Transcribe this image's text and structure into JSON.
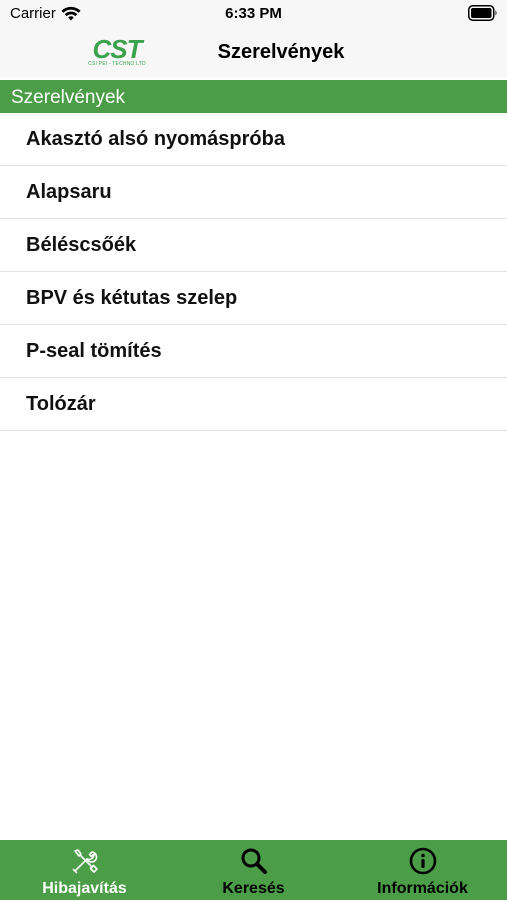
{
  "status_bar": {
    "carrier": "Carrier",
    "time": "6:33 PM",
    "wifi_icon": "wifi-icon",
    "battery_icon": "battery-icon"
  },
  "nav_bar": {
    "logo_text": "CST",
    "logo_subtext": "CSI PEI - TECHNO LTD",
    "title": "Szerelvények"
  },
  "section": {
    "header": "Szerelvények",
    "header_color": "#4b9e47"
  },
  "list": {
    "items": [
      {
        "label": "Akasztó alsó nyomáspróba"
      },
      {
        "label": "Alapsaru"
      },
      {
        "label": "Béléscsőék"
      },
      {
        "label": "BPV és kétutas szelep"
      },
      {
        "label": "P-seal tömítés"
      },
      {
        "label": "Tolózár"
      }
    ]
  },
  "tab_bar": {
    "background": "#4b9e47",
    "tabs": [
      {
        "label": "Hibajavítás",
        "icon": "tools-icon",
        "active": true
      },
      {
        "label": "Keresés",
        "icon": "search-icon",
        "active": false
      },
      {
        "label": "Információk",
        "icon": "info-icon",
        "active": false
      }
    ]
  }
}
